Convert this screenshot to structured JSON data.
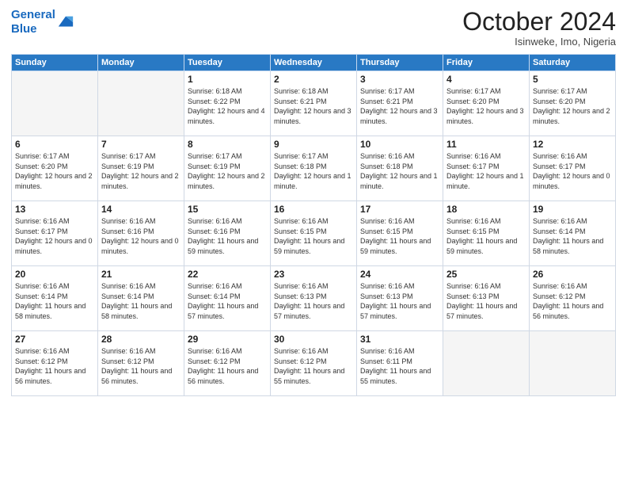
{
  "logo": {
    "line1": "General",
    "line2": "Blue"
  },
  "title": "October 2024",
  "location": "Isinweke, Imo, Nigeria",
  "days_of_week": [
    "Sunday",
    "Monday",
    "Tuesday",
    "Wednesday",
    "Thursday",
    "Friday",
    "Saturday"
  ],
  "weeks": [
    [
      {
        "day": "",
        "sunrise": "",
        "sunset": "",
        "daylight": ""
      },
      {
        "day": "",
        "sunrise": "",
        "sunset": "",
        "daylight": ""
      },
      {
        "day": "1",
        "sunrise": "Sunrise: 6:18 AM",
        "sunset": "Sunset: 6:22 PM",
        "daylight": "Daylight: 12 hours and 4 minutes."
      },
      {
        "day": "2",
        "sunrise": "Sunrise: 6:18 AM",
        "sunset": "Sunset: 6:21 PM",
        "daylight": "Daylight: 12 hours and 3 minutes."
      },
      {
        "day": "3",
        "sunrise": "Sunrise: 6:17 AM",
        "sunset": "Sunset: 6:21 PM",
        "daylight": "Daylight: 12 hours and 3 minutes."
      },
      {
        "day": "4",
        "sunrise": "Sunrise: 6:17 AM",
        "sunset": "Sunset: 6:20 PM",
        "daylight": "Daylight: 12 hours and 3 minutes."
      },
      {
        "day": "5",
        "sunrise": "Sunrise: 6:17 AM",
        "sunset": "Sunset: 6:20 PM",
        "daylight": "Daylight: 12 hours and 2 minutes."
      }
    ],
    [
      {
        "day": "6",
        "sunrise": "Sunrise: 6:17 AM",
        "sunset": "Sunset: 6:20 PM",
        "daylight": "Daylight: 12 hours and 2 minutes."
      },
      {
        "day": "7",
        "sunrise": "Sunrise: 6:17 AM",
        "sunset": "Sunset: 6:19 PM",
        "daylight": "Daylight: 12 hours and 2 minutes."
      },
      {
        "day": "8",
        "sunrise": "Sunrise: 6:17 AM",
        "sunset": "Sunset: 6:19 PM",
        "daylight": "Daylight: 12 hours and 2 minutes."
      },
      {
        "day": "9",
        "sunrise": "Sunrise: 6:17 AM",
        "sunset": "Sunset: 6:18 PM",
        "daylight": "Daylight: 12 hours and 1 minute."
      },
      {
        "day": "10",
        "sunrise": "Sunrise: 6:16 AM",
        "sunset": "Sunset: 6:18 PM",
        "daylight": "Daylight: 12 hours and 1 minute."
      },
      {
        "day": "11",
        "sunrise": "Sunrise: 6:16 AM",
        "sunset": "Sunset: 6:17 PM",
        "daylight": "Daylight: 12 hours and 1 minute."
      },
      {
        "day": "12",
        "sunrise": "Sunrise: 6:16 AM",
        "sunset": "Sunset: 6:17 PM",
        "daylight": "Daylight: 12 hours and 0 minutes."
      }
    ],
    [
      {
        "day": "13",
        "sunrise": "Sunrise: 6:16 AM",
        "sunset": "Sunset: 6:17 PM",
        "daylight": "Daylight: 12 hours and 0 minutes."
      },
      {
        "day": "14",
        "sunrise": "Sunrise: 6:16 AM",
        "sunset": "Sunset: 6:16 PM",
        "daylight": "Daylight: 12 hours and 0 minutes."
      },
      {
        "day": "15",
        "sunrise": "Sunrise: 6:16 AM",
        "sunset": "Sunset: 6:16 PM",
        "daylight": "Daylight: 11 hours and 59 minutes."
      },
      {
        "day": "16",
        "sunrise": "Sunrise: 6:16 AM",
        "sunset": "Sunset: 6:15 PM",
        "daylight": "Daylight: 11 hours and 59 minutes."
      },
      {
        "day": "17",
        "sunrise": "Sunrise: 6:16 AM",
        "sunset": "Sunset: 6:15 PM",
        "daylight": "Daylight: 11 hours and 59 minutes."
      },
      {
        "day": "18",
        "sunrise": "Sunrise: 6:16 AM",
        "sunset": "Sunset: 6:15 PM",
        "daylight": "Daylight: 11 hours and 59 minutes."
      },
      {
        "day": "19",
        "sunrise": "Sunrise: 6:16 AM",
        "sunset": "Sunset: 6:14 PM",
        "daylight": "Daylight: 11 hours and 58 minutes."
      }
    ],
    [
      {
        "day": "20",
        "sunrise": "Sunrise: 6:16 AM",
        "sunset": "Sunset: 6:14 PM",
        "daylight": "Daylight: 11 hours and 58 minutes."
      },
      {
        "day": "21",
        "sunrise": "Sunrise: 6:16 AM",
        "sunset": "Sunset: 6:14 PM",
        "daylight": "Daylight: 11 hours and 58 minutes."
      },
      {
        "day": "22",
        "sunrise": "Sunrise: 6:16 AM",
        "sunset": "Sunset: 6:14 PM",
        "daylight": "Daylight: 11 hours and 57 minutes."
      },
      {
        "day": "23",
        "sunrise": "Sunrise: 6:16 AM",
        "sunset": "Sunset: 6:13 PM",
        "daylight": "Daylight: 11 hours and 57 minutes."
      },
      {
        "day": "24",
        "sunrise": "Sunrise: 6:16 AM",
        "sunset": "Sunset: 6:13 PM",
        "daylight": "Daylight: 11 hours and 57 minutes."
      },
      {
        "day": "25",
        "sunrise": "Sunrise: 6:16 AM",
        "sunset": "Sunset: 6:13 PM",
        "daylight": "Daylight: 11 hours and 57 minutes."
      },
      {
        "day": "26",
        "sunrise": "Sunrise: 6:16 AM",
        "sunset": "Sunset: 6:12 PM",
        "daylight": "Daylight: 11 hours and 56 minutes."
      }
    ],
    [
      {
        "day": "27",
        "sunrise": "Sunrise: 6:16 AM",
        "sunset": "Sunset: 6:12 PM",
        "daylight": "Daylight: 11 hours and 56 minutes."
      },
      {
        "day": "28",
        "sunrise": "Sunrise: 6:16 AM",
        "sunset": "Sunset: 6:12 PM",
        "daylight": "Daylight: 11 hours and 56 minutes."
      },
      {
        "day": "29",
        "sunrise": "Sunrise: 6:16 AM",
        "sunset": "Sunset: 6:12 PM",
        "daylight": "Daylight: 11 hours and 56 minutes."
      },
      {
        "day": "30",
        "sunrise": "Sunrise: 6:16 AM",
        "sunset": "Sunset: 6:12 PM",
        "daylight": "Daylight: 11 hours and 55 minutes."
      },
      {
        "day": "31",
        "sunrise": "Sunrise: 6:16 AM",
        "sunset": "Sunset: 6:11 PM",
        "daylight": "Daylight: 11 hours and 55 minutes."
      },
      {
        "day": "",
        "sunrise": "",
        "sunset": "",
        "daylight": ""
      },
      {
        "day": "",
        "sunrise": "",
        "sunset": "",
        "daylight": ""
      }
    ]
  ]
}
